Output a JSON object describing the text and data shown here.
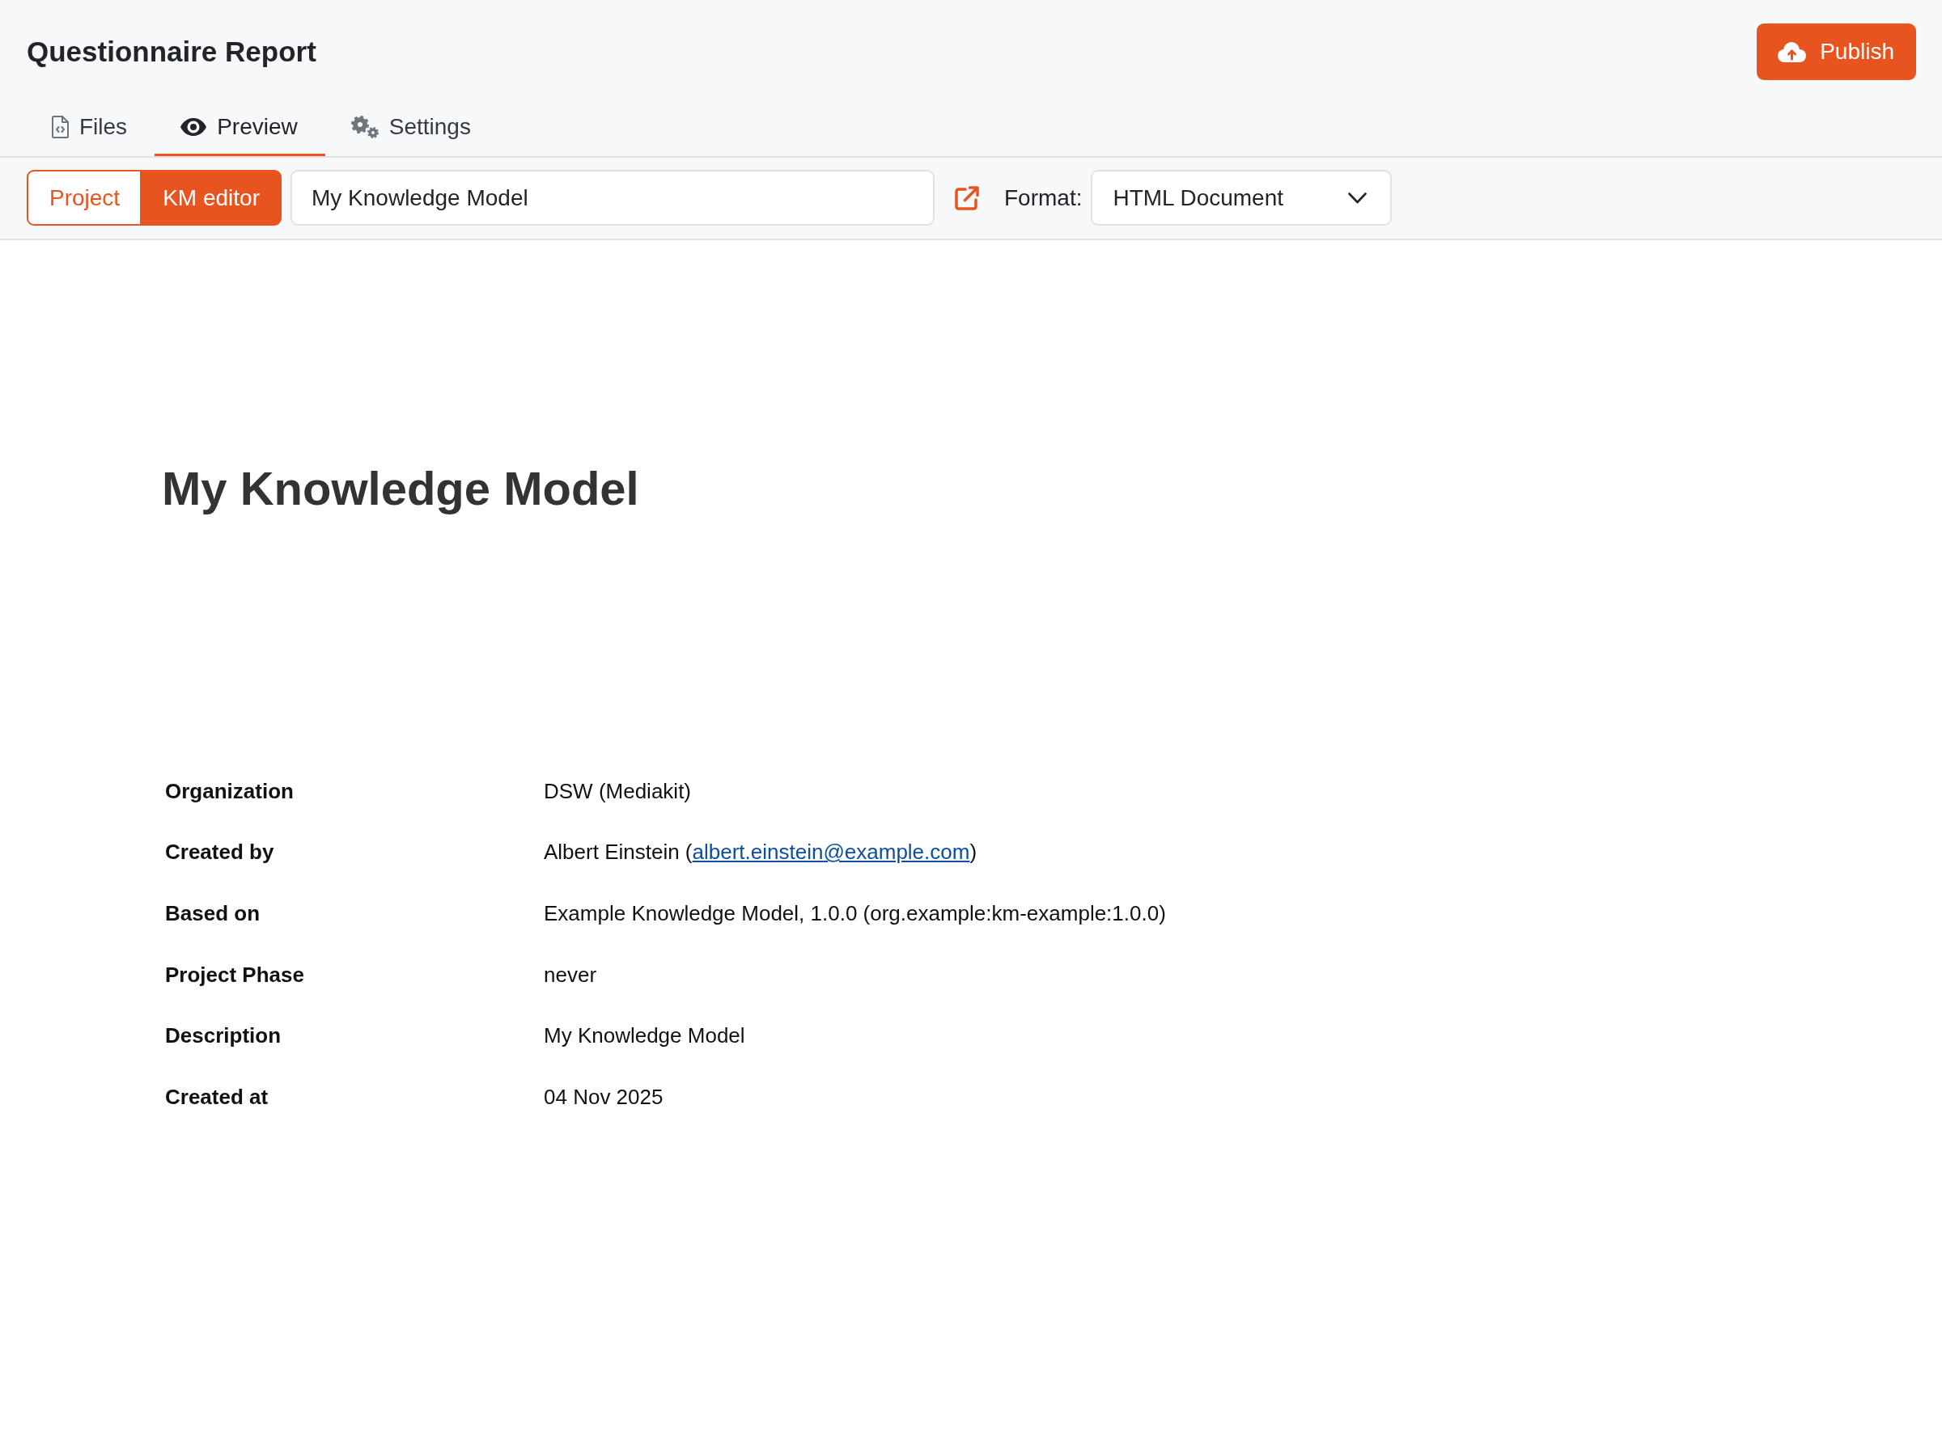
{
  "header": {
    "title": "Questionnaire Report",
    "publish_button": {
      "label": "Publish"
    }
  },
  "tabs": [
    {
      "kind": "files",
      "label": "Files",
      "selected": false
    },
    {
      "kind": "preview",
      "label": "Preview",
      "selected": true
    },
    {
      "kind": "settings",
      "label": "Settings",
      "selected": false
    }
  ],
  "toolbar": {
    "mode_switch": [
      {
        "label": "Project",
        "selected": false
      },
      {
        "label": "KM editor",
        "selected": true
      }
    ],
    "name_field": {
      "value": "My Knowledge Model"
    },
    "format": {
      "label": "Format:",
      "value": "HTML Document"
    }
  },
  "document": {
    "title": "My Knowledge Model",
    "details": [
      {
        "label": "Organization",
        "value": "DSW (Mediakit)"
      },
      {
        "label": "Created by",
        "value": "Albert Einstein (",
        "link": "albert.einstein@example.com",
        "value_end": ")"
      },
      {
        "label": "Based on",
        "value": "Example Knowledge Model, 1.0.0 (org.example:km-example:1.0.0)"
      },
      {
        "label": "Project Phase",
        "value": "never"
      },
      {
        "label": "Description",
        "value": "My Knowledge Model"
      },
      {
        "label": "Created at",
        "value": "04 Nov 2025"
      }
    ]
  }
}
